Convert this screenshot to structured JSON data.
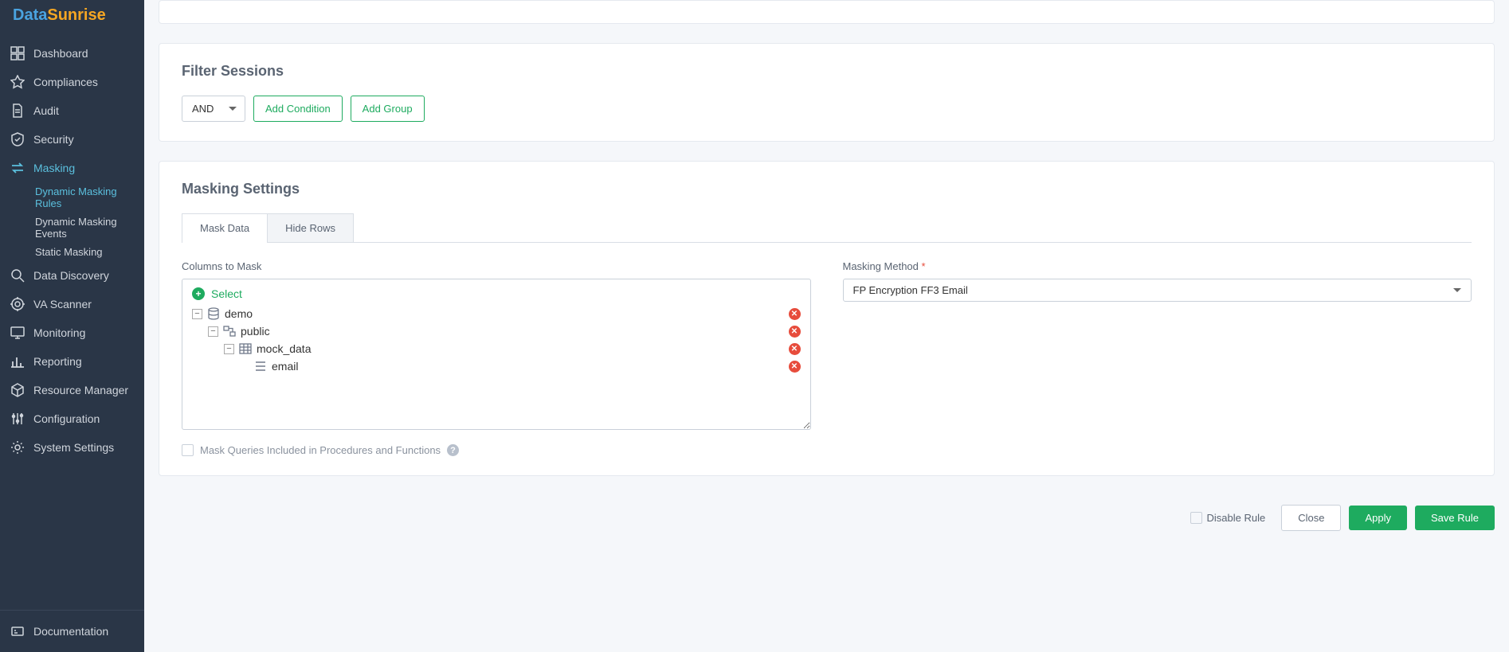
{
  "logo": {
    "part1": "Data",
    "part2": "Sunrise"
  },
  "sidebar": {
    "items": [
      {
        "label": "Dashboard",
        "icon": "dashboard"
      },
      {
        "label": "Compliances",
        "icon": "star"
      },
      {
        "label": "Audit",
        "icon": "document"
      },
      {
        "label": "Security",
        "icon": "shield"
      },
      {
        "label": "Masking",
        "icon": "swap",
        "active": true,
        "sub": [
          {
            "label": "Dynamic Masking Rules",
            "active": true
          },
          {
            "label": "Dynamic Masking Events"
          },
          {
            "label": "Static Masking"
          }
        ]
      },
      {
        "label": "Data Discovery",
        "icon": "search"
      },
      {
        "label": "VA Scanner",
        "icon": "target"
      },
      {
        "label": "Monitoring",
        "icon": "monitor"
      },
      {
        "label": "Reporting",
        "icon": "bars"
      },
      {
        "label": "Resource Manager",
        "icon": "cube"
      },
      {
        "label": "Configuration",
        "icon": "sliders"
      },
      {
        "label": "System Settings",
        "icon": "gear"
      }
    ],
    "footer": {
      "label": "Documentation",
      "icon": "doc"
    }
  },
  "filter": {
    "title": "Filter Sessions",
    "operator": "AND",
    "add_condition": "Add Condition",
    "add_group": "Add Group"
  },
  "masking": {
    "title": "Masking Settings",
    "tabs": [
      {
        "label": "Mask Data",
        "active": true
      },
      {
        "label": "Hide Rows"
      }
    ],
    "columns_label": "Columns to Mask",
    "select_label": "Select",
    "tree": {
      "db": "demo",
      "schema": "public",
      "table": "mock_data",
      "column": "email"
    },
    "mask_queries_label": "Mask Queries Included in Procedures and Functions",
    "method_label": "Masking Method",
    "method_value": "FP Encryption FF3 Email"
  },
  "footer": {
    "disable_label": "Disable Rule",
    "close": "Close",
    "apply": "Apply",
    "save": "Save Rule"
  }
}
